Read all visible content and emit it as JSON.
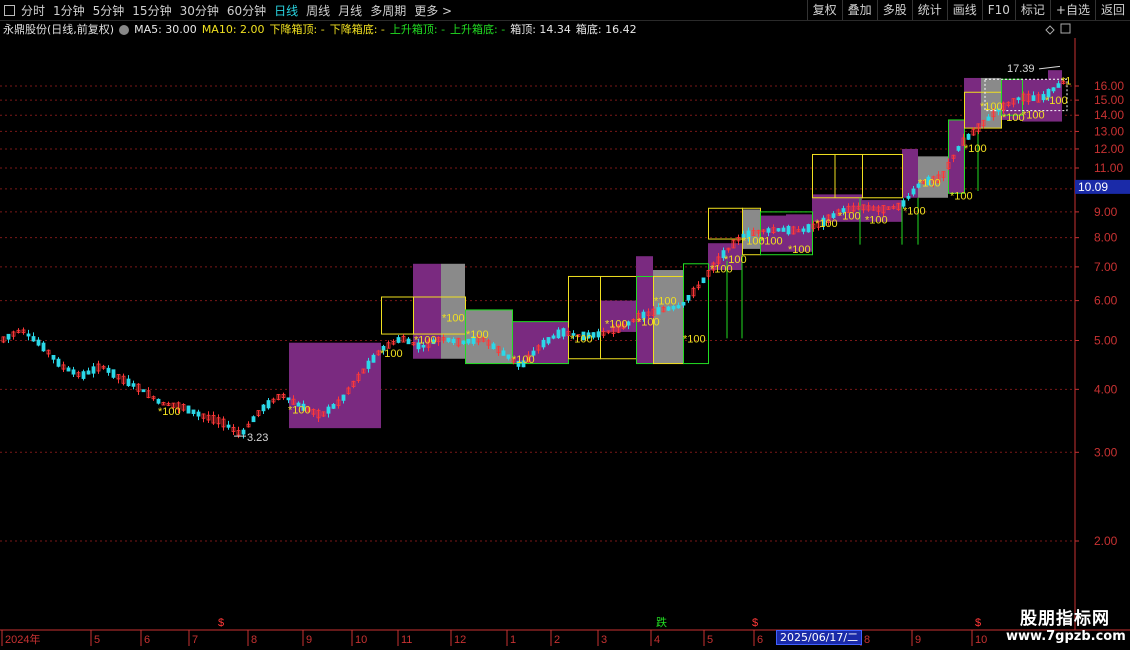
{
  "toolbar": {
    "period_tabs": [
      {
        "label": "分时",
        "name": "tab-intraday"
      },
      {
        "label": "1分钟",
        "name": "tab-1min"
      },
      {
        "label": "5分钟",
        "name": "tab-5min"
      },
      {
        "label": "15分钟",
        "name": "tab-15min"
      },
      {
        "label": "30分钟",
        "name": "tab-30min"
      },
      {
        "label": "60分钟",
        "name": "tab-60min"
      },
      {
        "label": "日线",
        "name": "tab-daily",
        "active": true
      },
      {
        "label": "周线",
        "name": "tab-weekly"
      },
      {
        "label": "月线",
        "name": "tab-monthly"
      },
      {
        "label": "多周期",
        "name": "tab-multi-period"
      },
      {
        "label": "更多 >",
        "name": "tab-more"
      }
    ],
    "right_buttons": [
      {
        "label": "复权",
        "name": "adjust-button"
      },
      {
        "label": "叠加",
        "name": "overlay-button"
      },
      {
        "label": "多股",
        "name": "multi-stock-button"
      },
      {
        "label": "统计",
        "name": "statistics-button"
      },
      {
        "label": "画线",
        "name": "draw-line-button"
      },
      {
        "label": "F10",
        "name": "f10-button"
      },
      {
        "label": "标记",
        "name": "mark-button"
      },
      {
        "label": "+自选",
        "name": "add-watchlist-button"
      },
      {
        "label": "返回",
        "name": "back-button"
      }
    ]
  },
  "info": {
    "stock": "永鼎股份(日线,前复权)",
    "ma5": "MA5: 30.00",
    "ma10": "MA10: 2.00",
    "down_top": "下降箱顶: -",
    "down_bottom": "下降箱底: -",
    "up_top": "上升箱顶: -",
    "up_bottom": "上升箱底: -",
    "box_top": "箱顶: 14.34",
    "box_bottom": "箱底: 16.42"
  },
  "colors": {
    "up": "#ff3838",
    "down": "#2cd8e8",
    "box_fill": "#7a2a80",
    "box_gray": "#8a8a8a",
    "yellow": "#f0e020",
    "green": "#22dd22",
    "grid": "#7a1818",
    "axis": "#c83232"
  },
  "chart_data": {
    "type": "candlestick",
    "y_ticks": [
      2.0,
      3.0,
      4.0,
      5.0,
      6.0,
      7.0,
      8.0,
      9.0,
      10.0,
      11.0,
      12.0,
      13.0,
      14.0,
      15.0,
      16.0
    ],
    "y_tick_labels": [
      "2.00",
      "3.00",
      "4.00",
      "5.00",
      "6.00",
      "7.00",
      "8.00",
      "9.00",
      "10.00",
      "11.00",
      "12.00",
      "13.00",
      "14.00",
      "15.00",
      "16.00"
    ],
    "price_scale": "log",
    "current_price": "10.09",
    "high_label": "17.39",
    "low_label": "3.23",
    "x_labels": [
      "2024年",
      "5",
      "6",
      "7",
      "8",
      "9",
      "10",
      "11",
      "12",
      "1",
      "2",
      "3",
      "4",
      "5",
      "6",
      "7",
      "8",
      "9",
      "10"
    ],
    "cursor_date": "2025/06/17/二",
    "markers": [
      {
        "text": "$",
        "color": "#ff3838"
      },
      {
        "text": "跌",
        "color": "#22dd22"
      },
      {
        "text": "$",
        "color": "#ff3838"
      },
      {
        "text": "$",
        "color": "#ff3838"
      }
    ],
    "signal_label": "*100",
    "partial_signal_label": "*1",
    "path_points": [
      [
        0,
        5.0
      ],
      [
        20,
        5.25
      ],
      [
        40,
        4.9
      ],
      [
        60,
        4.45
      ],
      [
        80,
        4.25
      ],
      [
        100,
        4.45
      ],
      [
        120,
        4.2
      ],
      [
        140,
        4.0
      ],
      [
        160,
        3.75
      ],
      [
        180,
        3.7
      ],
      [
        200,
        3.55
      ],
      [
        220,
        3.45
      ],
      [
        240,
        3.25
      ],
      [
        260,
        3.65
      ],
      [
        280,
        3.9
      ],
      [
        300,
        3.7
      ],
      [
        320,
        3.55
      ],
      [
        340,
        3.8
      ],
      [
        360,
        4.3
      ],
      [
        380,
        4.8
      ],
      [
        400,
        5.05
      ],
      [
        420,
        4.85
      ],
      [
        440,
        5.05
      ],
      [
        460,
        4.95
      ],
      [
        480,
        5.05
      ],
      [
        500,
        4.75
      ],
      [
        520,
        4.45
      ],
      [
        540,
        4.9
      ],
      [
        560,
        5.2
      ],
      [
        580,
        5.1
      ],
      [
        600,
        5.15
      ],
      [
        620,
        5.3
      ],
      [
        640,
        5.6
      ],
      [
        660,
        5.75
      ],
      [
        680,
        5.85
      ],
      [
        700,
        6.5
      ],
      [
        720,
        7.35
      ],
      [
        740,
        8.05
      ],
      [
        760,
        8.25
      ],
      [
        780,
        8.3
      ],
      [
        800,
        8.25
      ],
      [
        820,
        8.55
      ],
      [
        840,
        9.05
      ],
      [
        860,
        9.2
      ],
      [
        880,
        9.1
      ],
      [
        900,
        9.25
      ],
      [
        920,
        10.3
      ],
      [
        940,
        10.5
      ],
      [
        960,
        12.3
      ],
      [
        980,
        13.4
      ],
      [
        1000,
        14.5
      ],
      [
        1020,
        15.2
      ],
      [
        1040,
        15.1
      ],
      [
        1060,
        16.2
      ],
      [
        1068,
        16.4
      ]
    ]
  },
  "watermark": {
    "title": "股朋指标网",
    "url": "www.7gpzb.com"
  }
}
